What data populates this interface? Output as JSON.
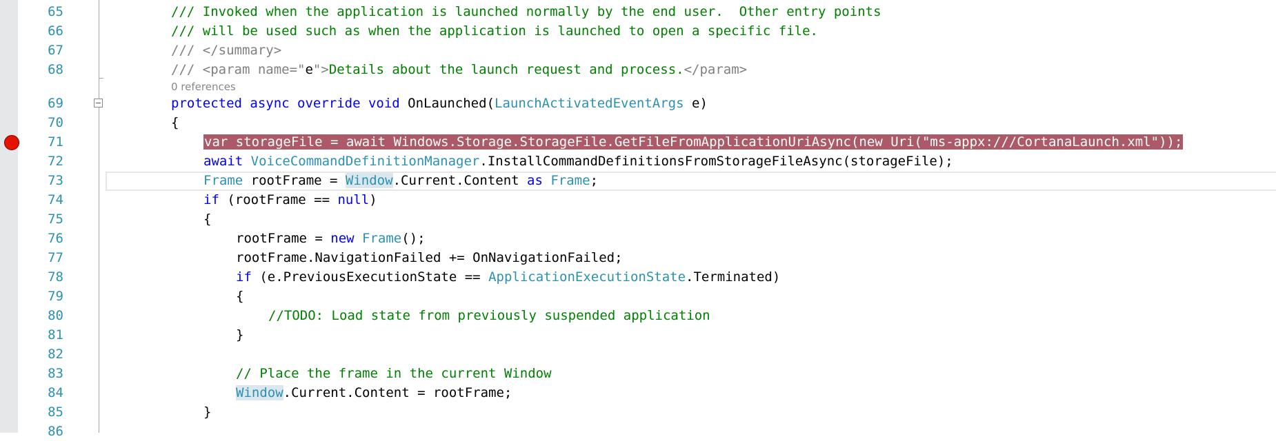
{
  "editor": {
    "lines": [
      {
        "n": "65",
        "parts": [
          [
            "cm",
            "/// Invoked when the application is launched normally by the end user.  Other entry points"
          ]
        ]
      },
      {
        "n": "66",
        "parts": [
          [
            "cm",
            "/// will be used such as when the application is launched to open a specific file."
          ]
        ]
      },
      {
        "n": "67",
        "parts": [
          [
            "xml",
            "/// </summary>"
          ]
        ]
      },
      {
        "n": "68",
        "parts": [
          [
            "xml",
            "/// <param name=\""
          ],
          [
            "plain",
            "e"
          ],
          [
            "xml",
            "\">"
          ],
          [
            "cm",
            "Details about the launch request and process."
          ],
          [
            "xml",
            "</param>"
          ]
        ]
      },
      {
        "n": "69",
        "parts": [
          [
            "kw",
            "protected async override void "
          ],
          [
            "plain",
            "OnLaunched("
          ],
          [
            "ty",
            "LaunchActivatedEventArgs"
          ],
          [
            "plain",
            " e)"
          ]
        ]
      },
      {
        "n": "70",
        "parts": [
          [
            "plain",
            "{"
          ]
        ]
      },
      {
        "n": "71",
        "indent": 1,
        "parts": [
          [
            "bp",
            "var storageFile = await Windows.Storage.StorageFile.GetFileFromApplicationUriAsync(new Uri(\"ms-appx:///CortanaLaunch.xml\"));"
          ]
        ]
      },
      {
        "n": "72",
        "indent": 1,
        "parts": [
          [
            "kw",
            "await "
          ],
          [
            "ty",
            "VoiceCommandDefinitionManager"
          ],
          [
            "plain",
            ".InstallCommandDefinitionsFromStorageFileAsync(storageFile);"
          ]
        ]
      },
      {
        "n": "73",
        "indent": 1,
        "parts": [
          [
            "ty",
            "Frame"
          ],
          [
            "plain",
            " rootFrame = "
          ],
          [
            "tyhl",
            "Window"
          ],
          [
            "plain",
            ".Current.Content "
          ],
          [
            "kw",
            "as "
          ],
          [
            "ty",
            "Frame"
          ],
          [
            "plain",
            ";"
          ]
        ]
      },
      {
        "n": "74",
        "indent": 1,
        "parts": [
          [
            "kw",
            "if"
          ],
          [
            "plain",
            " (rootFrame == "
          ],
          [
            "kw",
            "null"
          ],
          [
            "plain",
            ")"
          ]
        ]
      },
      {
        "n": "75",
        "indent": 1,
        "parts": [
          [
            "plain",
            "{"
          ]
        ]
      },
      {
        "n": "76",
        "indent": 2,
        "parts": [
          [
            "plain",
            "rootFrame = "
          ],
          [
            "kw",
            "new "
          ],
          [
            "ty",
            "Frame"
          ],
          [
            "plain",
            "();"
          ]
        ]
      },
      {
        "n": "77",
        "indent": 2,
        "parts": [
          [
            "plain",
            "rootFrame.NavigationFailed += OnNavigationFailed;"
          ]
        ]
      },
      {
        "n": "78",
        "indent": 2,
        "parts": [
          [
            "kw",
            "if"
          ],
          [
            "plain",
            " (e.PreviousExecutionState == "
          ],
          [
            "ty",
            "ApplicationExecutionState"
          ],
          [
            "plain",
            ".Terminated)"
          ]
        ]
      },
      {
        "n": "79",
        "indent": 2,
        "parts": [
          [
            "plain",
            "{"
          ]
        ]
      },
      {
        "n": "80",
        "indent": 3,
        "parts": [
          [
            "cm",
            "//TODO: Load state from previously suspended application"
          ]
        ]
      },
      {
        "n": "81",
        "indent": 2,
        "parts": [
          [
            "plain",
            "}"
          ]
        ]
      },
      {
        "n": "82",
        "indent": 2,
        "parts": []
      },
      {
        "n": "83",
        "indent": 2,
        "parts": [
          [
            "cm",
            "// Place the frame in the current Window"
          ]
        ]
      },
      {
        "n": "84",
        "indent": 2,
        "parts": [
          [
            "tyhl",
            "Window"
          ],
          [
            "plain",
            ".Current.Content = rootFrame;"
          ]
        ]
      },
      {
        "n": "85",
        "indent": 1,
        "parts": [
          [
            "plain",
            "}"
          ]
        ]
      },
      {
        "n": "86",
        "indent": 1,
        "parts": []
      }
    ],
    "codelens_text": "0 references"
  },
  "colors": {
    "line_number": "#2b91af",
    "comment": "#008000",
    "keyword": "#0000ff",
    "type": "#2b91af",
    "breakpoint": "#e51400",
    "breakpoint_highlight": "#ad5a68"
  }
}
